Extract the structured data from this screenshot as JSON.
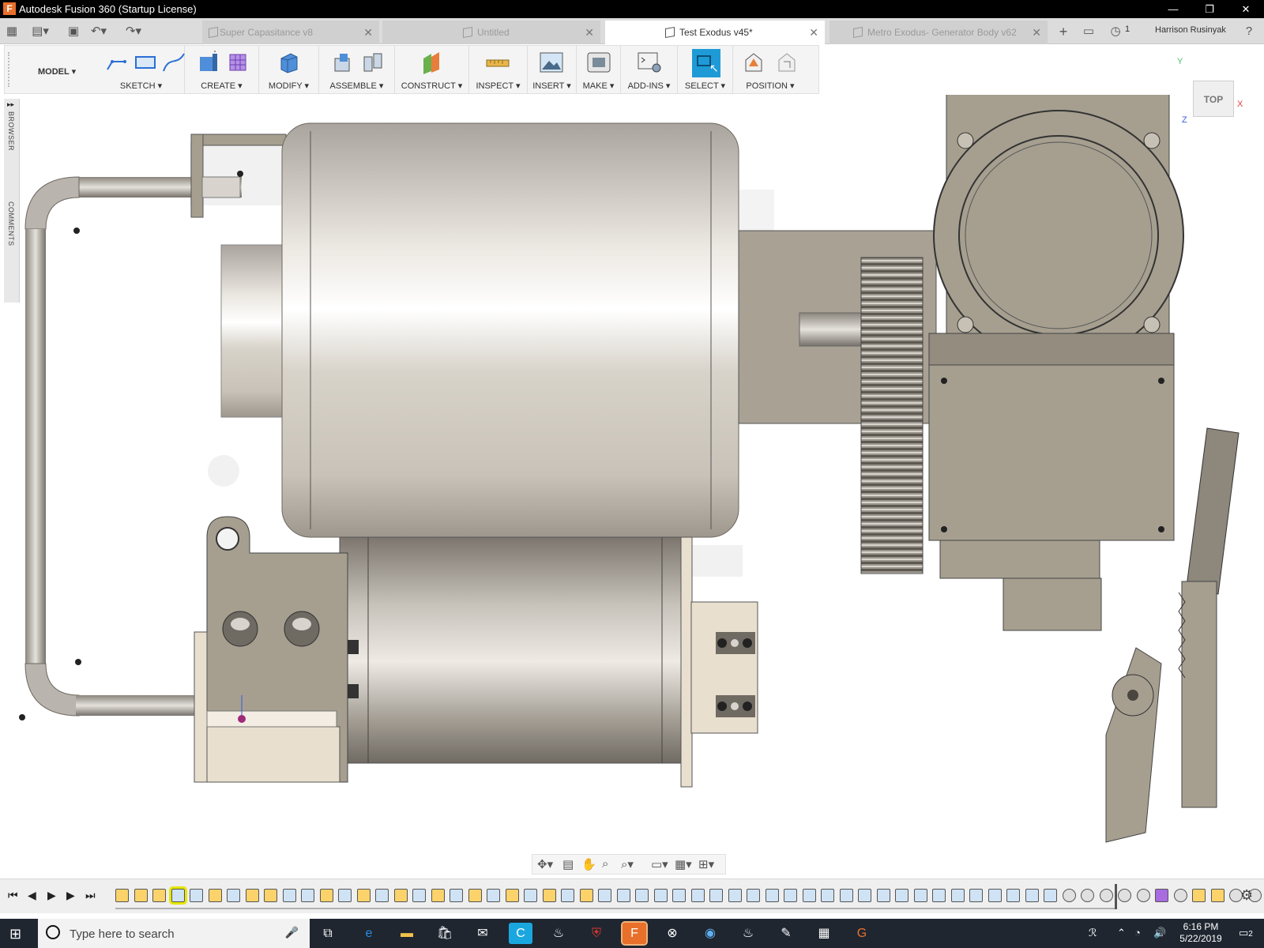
{
  "window": {
    "title": "Autodesk Fusion 360 (Startup License)",
    "icon_letter": "F"
  },
  "tabs": [
    {
      "label": "Super Capasitance v8",
      "active": false
    },
    {
      "label": "Untitled",
      "active": false
    },
    {
      "label": "Test Exodus v45*",
      "active": true
    },
    {
      "label": "Metro Exodus- Generator Body v62",
      "active": false
    }
  ],
  "header": {
    "job_count": "1",
    "user": "Harrison Rusinyak"
  },
  "toolbar": {
    "workspace": "MODEL",
    "groups": [
      "SKETCH",
      "CREATE",
      "MODIFY",
      "ASSEMBLE",
      "CONSTRUCT",
      "INSPECT",
      "INSERT",
      "MAKE",
      "ADD-INS",
      "SELECT",
      "POSITION"
    ]
  },
  "side_panel": {
    "browser": "BROWSER",
    "comments": "COMMENTS"
  },
  "viewcube": {
    "face": "TOP",
    "axis_x": "X",
    "axis_y": "Y",
    "axis_z": "Z"
  },
  "taskbar": {
    "search_placeholder": "Type here to search",
    "time": "6:16 PM",
    "date": "5/22/2019",
    "notifications": "2"
  },
  "colors": {
    "accent": "#1e9bd7",
    "sketch_feature": "#fbd36a",
    "selected_feature": "#e6e600",
    "part_beige": "#a69f90",
    "part_light": "#e9dfcf"
  },
  "icons": [
    "grid-icon",
    "file-icon",
    "save-icon",
    "undo-icon",
    "redo-icon",
    "new-tab-icon",
    "chat-icon",
    "clock-icon",
    "help-icon",
    "gear-icon"
  ]
}
